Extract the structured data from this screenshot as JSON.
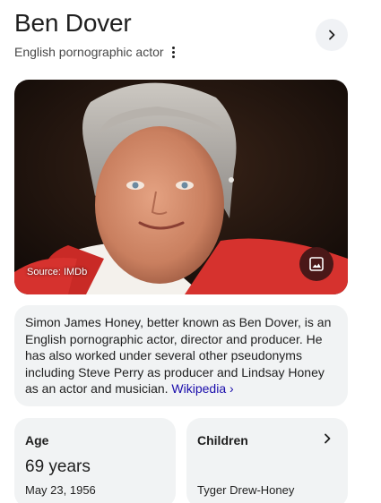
{
  "panel": {
    "title": "Ben Dover",
    "subtitle": "English pornographic actor",
    "more_icon": "more-vert-icon",
    "next_icon": "chevron-right-icon"
  },
  "photo": {
    "source_label": "Source: IMDb",
    "image_button_icon": "image-icon"
  },
  "description": {
    "text": "Simon James Honey, better known as Ben Dover, is an English pornographic actor, director and producer. He has also worked under several other pseudonyms including Steve Perry as producer and Lindsay Honey as an actor and musician. ",
    "link_label": "Wikipedia ›"
  },
  "facts": {
    "age": {
      "label": "Age",
      "value": "69 years",
      "detail": "May 23, 1956"
    },
    "children": {
      "label": "Children",
      "value": "Tyger Drew-Honey"
    }
  },
  "colors": {
    "link": "#1a0dab",
    "card_bg": "#f1f3f4",
    "image_button_bg": "#4a1818"
  }
}
